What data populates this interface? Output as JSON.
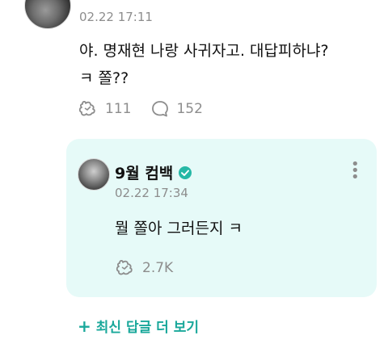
{
  "top_comment": {
    "author": "",
    "timestamp": "02.22 17:11",
    "text_line1": "야. 명재현 나랑 사귀자고. 대답피하냐?",
    "text_line2": "ㅋ 쫄??",
    "likes": "111",
    "replies": "152",
    "like_icon": "puzzle-heart-icon",
    "reply_icon": "speech-bubble-icon"
  },
  "reply": {
    "author": "9월 컴백",
    "verified_icon": "verified-badge-icon",
    "timestamp": "02.22 17:34",
    "text": "뭘 쫄아 그러든지 ㅋ",
    "likes": "2.7K",
    "like_icon": "puzzle-heart-icon"
  },
  "more_replies": {
    "label": "최신 답글 더 보기",
    "plus_symbol": "+"
  },
  "colors": {
    "reply_background": "#e6faf8",
    "accent_teal": "#1aa89b",
    "meta_gray": "#8d8d8d"
  }
}
